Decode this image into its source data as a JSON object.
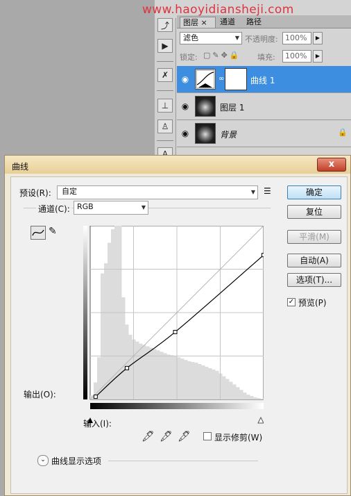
{
  "watermark": "www.haoyidiansheji.com",
  "layers_panel": {
    "tabs": [
      "图层",
      "通道",
      "路径"
    ],
    "tab_close": "×",
    "blend_mode": "滤色",
    "opacity_label": "不透明度:",
    "opacity_value": "100%",
    "lock_label": "锁定:",
    "fill_label": "填充:",
    "fill_value": "100%",
    "layers": [
      {
        "name": "曲线 1",
        "selected": true
      },
      {
        "name": "图层 1",
        "selected": false
      },
      {
        "name": "背景",
        "selected": false,
        "locked": true
      }
    ]
  },
  "dialog": {
    "title": "曲线",
    "close_label": "x",
    "preset_label": "预设(R):",
    "preset_value": "自定",
    "channel_label": "通道(C):",
    "channel_value": "RGB",
    "output_label": "输出(O):",
    "input_label": "输入(I):",
    "show_clipping_label": "显示修剪(W)",
    "curve_options_label": "曲线显示选项",
    "buttons": {
      "ok": "确定",
      "reset": "复位",
      "smooth": "平滑(M)",
      "auto": "自动(A)",
      "options": "选项(T)...",
      "preview": "预览(P)"
    },
    "preview_checked": true,
    "show_clipping_checked": false
  },
  "chart_data": {
    "type": "line",
    "xlim": [
      0,
      255
    ],
    "ylim": [
      0,
      255
    ],
    "grid": "4x4",
    "curve_points": [
      [
        8,
        4
      ],
      [
        54,
        46
      ],
      [
        125,
        99
      ],
      [
        255,
        212
      ]
    ],
    "histogram": [
      6,
      25,
      62,
      185,
      200,
      230,
      250,
      255,
      255,
      150,
      110,
      95,
      88,
      85,
      82,
      80,
      78,
      76,
      74,
      72,
      70,
      68,
      66,
      65,
      64,
      62,
      60,
      58,
      56,
      55,
      54,
      52,
      50,
      48,
      46,
      44,
      42,
      38,
      34,
      30,
      26,
      22,
      18,
      14,
      10,
      7,
      5,
      3,
      2,
      1
    ]
  }
}
